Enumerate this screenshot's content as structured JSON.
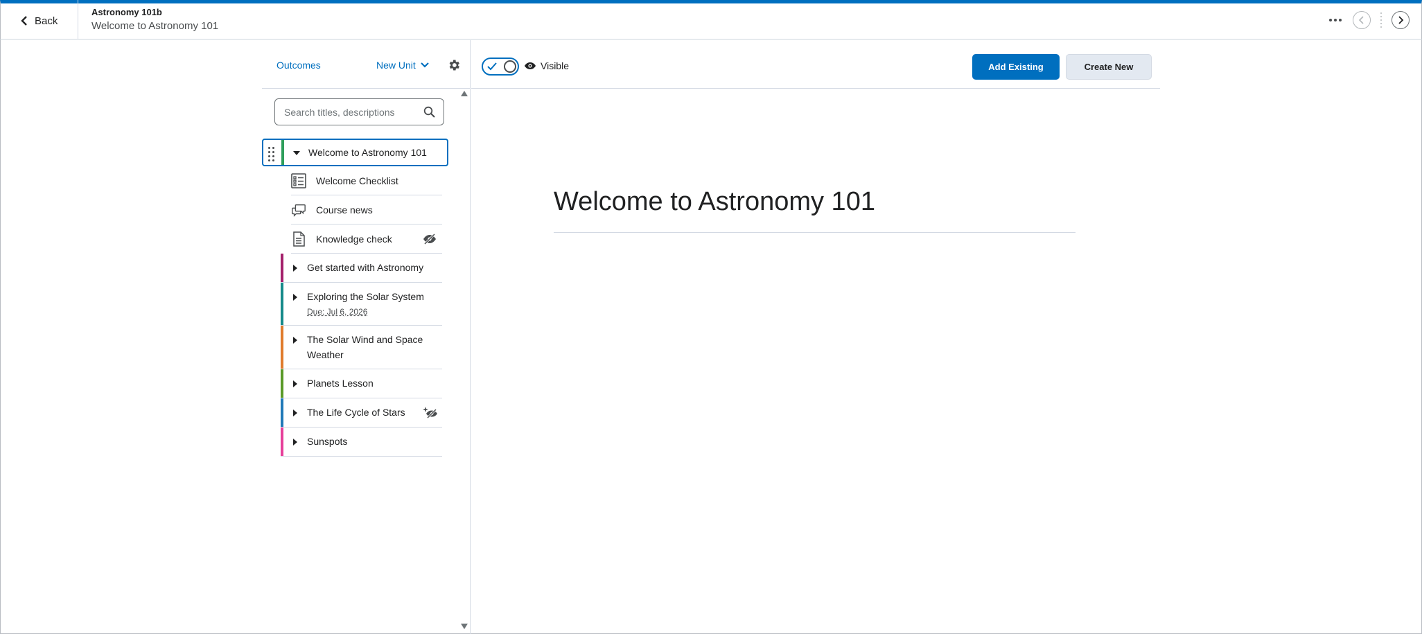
{
  "header": {
    "back_label": "Back",
    "course_name": "Astronomy 101b",
    "page_title": "Welcome to Astronomy 101"
  },
  "sidebar": {
    "outcomes_label": "Outcomes",
    "new_unit_label": "New Unit",
    "search_placeholder": "Search titles, descriptions",
    "selected_unit": {
      "title": "Welcome to Astronomy 101",
      "color": "#2e9e5b",
      "topics": [
        {
          "title": "Welcome Checklist",
          "icon": "checklist-icon",
          "hidden": false
        },
        {
          "title": "Course news",
          "icon": "discussion-icon",
          "hidden": false
        },
        {
          "title": "Knowledge check",
          "icon": "document-icon",
          "hidden": true
        }
      ]
    },
    "units": [
      {
        "title": "Get started with Astronomy",
        "color": "#a4206b",
        "due": "",
        "badge": ""
      },
      {
        "title": "Exploring the Solar System",
        "color": "#168a8a",
        "due": "Due: Jul 6, 2026",
        "badge": ""
      },
      {
        "title": "The Solar Wind and Space Weather",
        "color": "#e07b2c",
        "due": "",
        "badge": ""
      },
      {
        "title": "Planets Lesson",
        "color": "#5a9a28",
        "due": "",
        "badge": ""
      },
      {
        "title": "The Life Cycle of Stars",
        "color": "#2079b8",
        "due": "",
        "badge": "sparkle-hidden-icon"
      },
      {
        "title": "Sunspots",
        "color": "#e6409a",
        "due": "",
        "badge": ""
      }
    ]
  },
  "toolbar": {
    "visibility_label": "Visible",
    "add_existing_label": "Add Existing",
    "create_new_label": "Create New"
  },
  "content": {
    "title": "Welcome to Astronomy 101"
  },
  "colors": {
    "brand": "#006fbf",
    "text": "#202122",
    "border": "#d3d9e3"
  }
}
